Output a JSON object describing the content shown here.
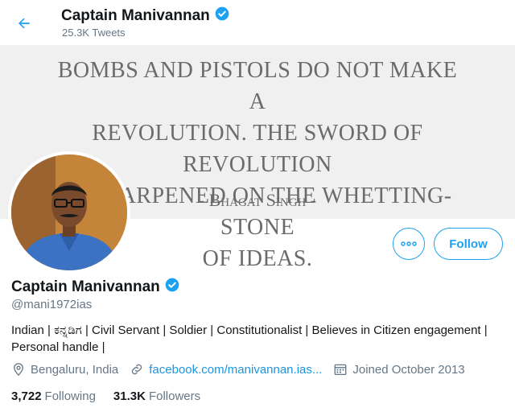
{
  "header": {
    "name": "Captain Manivannan",
    "tweet_count": "25.3K Tweets"
  },
  "banner": {
    "quote_lines": [
      "Bombs and pistols do not make a",
      "revolution. The sword of revolution",
      "is sharpened on the whetting-stone",
      "of ideas."
    ],
    "author": "- Bhagat Singh -"
  },
  "actions": {
    "follow_label": "Follow"
  },
  "profile": {
    "name": "Captain Manivannan",
    "handle": "@mani1972ias",
    "bio": "Indian | ಕನ್ನಡಿಗ | Civil Servant | Soldier | Constitutionalist | Believes in Citizen engagement | Personal handle |",
    "location": "Bengaluru, India",
    "link": "facebook.com/manivannan.ias...",
    "joined": "Joined October 2013"
  },
  "stats": {
    "following_count": "3,722",
    "following_label": "Following",
    "followers_count": "31.3K",
    "followers_label": "Followers"
  },
  "colors": {
    "accent": "#1da1f2",
    "verified": "#1da1f2",
    "banner_bg": "#f0f0f0",
    "secondary_text": "#657786"
  },
  "icons": {
    "back": "arrow-left-icon",
    "verified": "verified-badge-icon",
    "more": "more-dots-icon",
    "location": "location-pin-icon",
    "link": "link-icon",
    "calendar": "calendar-icon"
  }
}
